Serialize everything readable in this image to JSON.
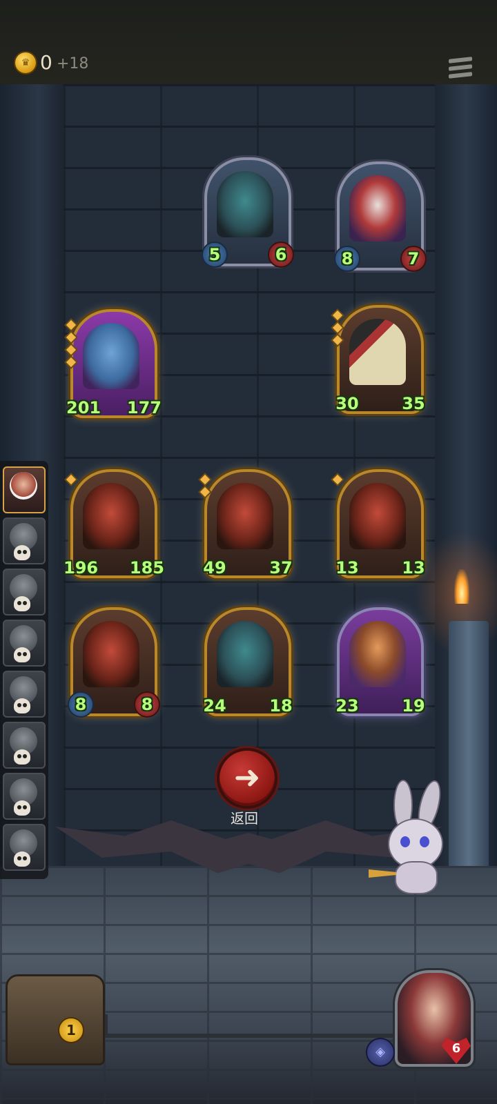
{
  "header": {
    "coin_icon": "crown-coin-icon",
    "coins": "0",
    "coin_bonus": "+18",
    "menu_icon": "menu-icon"
  },
  "board": {
    "cards": [
      {
        "id": "yeti-top",
        "art": "yeti",
        "frame": "silver",
        "attack": "5",
        "health": "6",
        "gems": 0
      },
      {
        "id": "clown-top",
        "art": "clown",
        "frame": "silver",
        "attack": "8",
        "health": "7",
        "gems": 0
      },
      {
        "id": "dragon-left",
        "art": "dragon",
        "frame": "gold",
        "attack": "201",
        "health": "177",
        "gems": 4
      },
      {
        "id": "spade-right",
        "art": "spade",
        "frame": "gold",
        "attack": "30",
        "health": "35",
        "gems": 3
      },
      {
        "id": "demon-1",
        "art": "demon",
        "frame": "gold",
        "attack": "196",
        "health": "185",
        "gems": 1
      },
      {
        "id": "demon-2",
        "art": "demon",
        "frame": "gold",
        "attack": "49",
        "health": "37",
        "gems": 2
      },
      {
        "id": "demon-3",
        "art": "demon",
        "frame": "gold",
        "attack": "13",
        "health": "13",
        "gems": 1
      },
      {
        "id": "demon-4",
        "art": "demon",
        "frame": "gold",
        "attack": "8",
        "health": "8",
        "gems": 0
      },
      {
        "id": "yeti-bottom",
        "art": "yeti",
        "frame": "gold",
        "attack": "24",
        "health": "18",
        "gems": 0
      },
      {
        "id": "archer",
        "art": "archer",
        "frame": "purple",
        "attack": "23",
        "health": "19",
        "gems": 0
      }
    ]
  },
  "back_button": {
    "icon": "arrow-left-icon",
    "label": "返回"
  },
  "roster": {
    "slots": [
      "hero",
      "eliminated",
      "eliminated",
      "eliminated",
      "eliminated",
      "eliminated",
      "eliminated",
      "eliminated"
    ]
  },
  "chest": {
    "badge": "1"
  },
  "hero": {
    "armor_icon": "shield-icon",
    "health": "6"
  },
  "colors": {
    "stat_text": "#b6ff7a",
    "gold_frame": "#b8882b",
    "back_button": "#b52420"
  }
}
